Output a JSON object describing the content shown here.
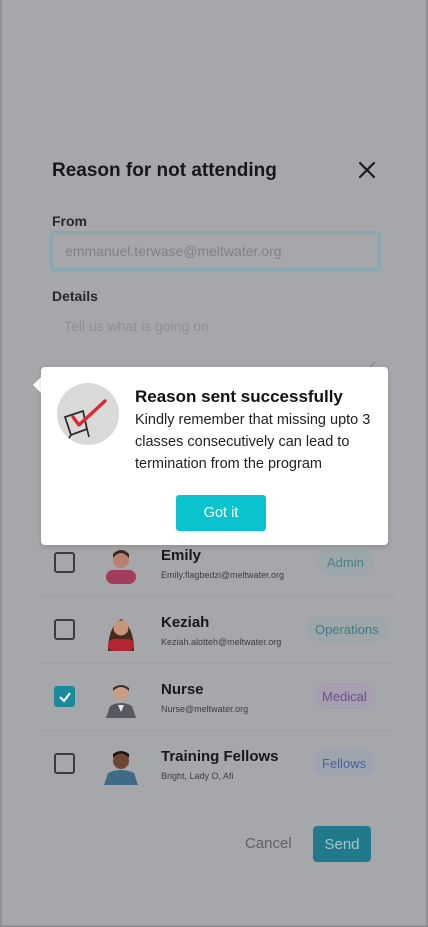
{
  "dialog": {
    "title": "Reason for not attending",
    "from_label": "From",
    "from_value": "emmanuel.terwase@meltwater.org",
    "details_label": "Details",
    "details_placeholder": "Tell us what is going on"
  },
  "recipients": [
    {
      "name": "Emily",
      "subtitle": "Emily.flagbedzi@meltwater.org",
      "tag": "Admin",
      "checked": false
    },
    {
      "name": "Keziah",
      "subtitle": "Keziah.alotteh@meltwater.org",
      "tag": "Operations",
      "checked": false
    },
    {
      "name": "Nurse",
      "subtitle": "Nurse@meltwater.org",
      "tag": "Medical",
      "checked": true
    },
    {
      "name": "Training Fellows",
      "subtitle": "Bright, Lady O, Afi",
      "tag": "Fellows",
      "checked": false
    }
  ],
  "actions": {
    "cancel": "Cancel",
    "send": "Send"
  },
  "popup": {
    "title": "Reason sent successfully",
    "body": "Kindly remember that missing upto 3 classes consecutively can lead to termination from the program",
    "button": "Got it",
    "icon": "checklist-icon"
  },
  "colors": {
    "accent": "#0bc3cf",
    "send_bg": "#217a8c",
    "overlay": "#a6a7aa"
  }
}
